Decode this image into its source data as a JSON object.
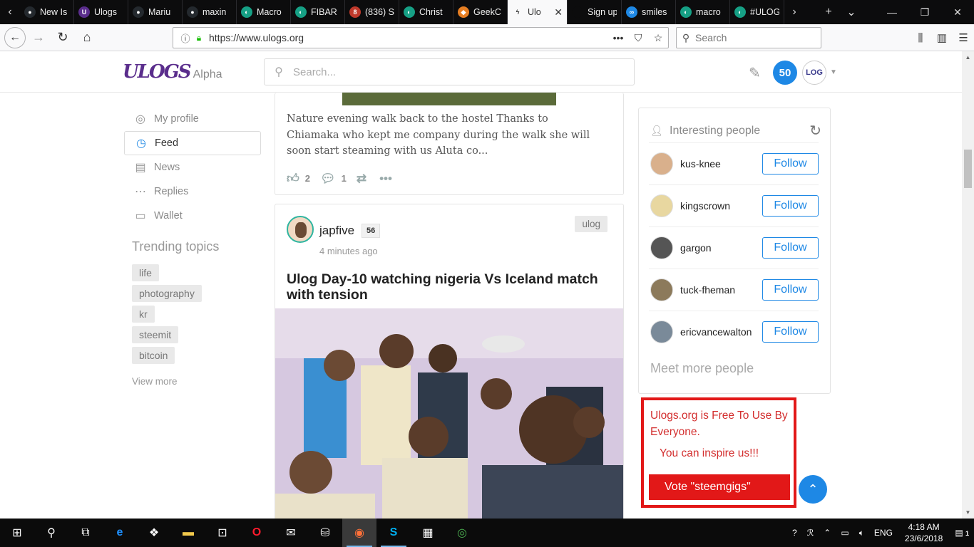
{
  "browser": {
    "tabs": [
      {
        "title": "New Is",
        "favicon_color": "#24292e",
        "favicon_text": "●"
      },
      {
        "title": "Ulogs",
        "favicon_color": "#5a2d8c",
        "favicon_text": "U"
      },
      {
        "title": "Mariu",
        "favicon_color": "#24292e",
        "favicon_text": "●"
      },
      {
        "title": "maxin",
        "favicon_color": "#24292e",
        "favicon_text": "●"
      },
      {
        "title": "Macro",
        "favicon_color": "#16a085",
        "favicon_text": "◐"
      },
      {
        "title": "FIBAR",
        "favicon_color": "#16a085",
        "favicon_text": "◐"
      },
      {
        "title": "(836) S",
        "favicon_color": "#c0392b",
        "favicon_text": "8"
      },
      {
        "title": "Christ",
        "favicon_color": "#16a085",
        "favicon_text": "◐"
      },
      {
        "title": "GeekC",
        "favicon_color": "#e67e22",
        "favicon_text": "◆"
      },
      {
        "title": "Ulo",
        "favicon_color": "#f9f9fa",
        "favicon_text": "ϟ",
        "active": true
      },
      {
        "title": "Sign up or",
        "favicon_color": "#0c0c0d",
        "favicon_text": ""
      },
      {
        "title": "smiles",
        "favicon_color": "#1e88e5",
        "favicon_text": "∞"
      },
      {
        "title": "macro",
        "favicon_color": "#16a085",
        "favicon_text": "◐"
      },
      {
        "title": "#ULOG",
        "favicon_color": "#16a085",
        "favicon_text": "◐"
      }
    ],
    "url": "https://www.ulogs.org",
    "search_placeholder": "Search"
  },
  "site": {
    "logo_text": "ULOGS",
    "alpha_label": "Alpha",
    "search_placeholder": "Search...",
    "notification_count": "50"
  },
  "sidebar": {
    "items": [
      {
        "label": "My profile",
        "icon": "profile-icon"
      },
      {
        "label": "Feed",
        "icon": "clock-icon",
        "active": true
      },
      {
        "label": "News",
        "icon": "news-icon"
      },
      {
        "label": "Replies",
        "icon": "replies-icon"
      },
      {
        "label": "Wallet",
        "icon": "wallet-icon"
      }
    ],
    "trending_title": "Trending topics",
    "topics": [
      "life",
      "photography",
      "kr",
      "steemit",
      "bitcoin"
    ],
    "view_more": "View more"
  },
  "feed": {
    "prev_post": {
      "excerpt": "Nature evening walk back to the hostel Thanks to Chiamaka who kept me company during the walk she will soon start steaming with us Aluta co...",
      "likes": "2",
      "comments": "1"
    },
    "post": {
      "author": "japfive",
      "reputation": "56",
      "time": "4 minutes ago",
      "category": "ulog",
      "title": "Ulog Day-10 watching nigeria Vs Iceland match with tension"
    }
  },
  "people": {
    "title": "Interesting people",
    "list": [
      {
        "name": "kus-knee",
        "follow": "Follow",
        "avatar_color": "#d9b08c"
      },
      {
        "name": "kingscrown",
        "follow": "Follow",
        "avatar_color": "#e8d7a0"
      },
      {
        "name": "gargon",
        "follow": "Follow",
        "avatar_color": "#555555"
      },
      {
        "name": "tuck-fheman",
        "follow": "Follow",
        "avatar_color": "#8c7a5b"
      },
      {
        "name": "ericvancewalton",
        "follow": "Follow",
        "avatar_color": "#7a8a99"
      }
    ],
    "meet_more": "Meet more people"
  },
  "promo": {
    "line1": "Ulogs.org is Free To Use By Everyone.",
    "line2": "You can inspire us!!!",
    "vote": "Vote \"steemgigs\""
  },
  "taskbar": {
    "time": "4:18 AM",
    "date": "23/6/2018",
    "lang": "ENG",
    "notif_count": "1"
  },
  "colors": {
    "accent": "#1e88e5",
    "promo_red": "#e21818",
    "browser_dark": "#0c0c0d"
  }
}
